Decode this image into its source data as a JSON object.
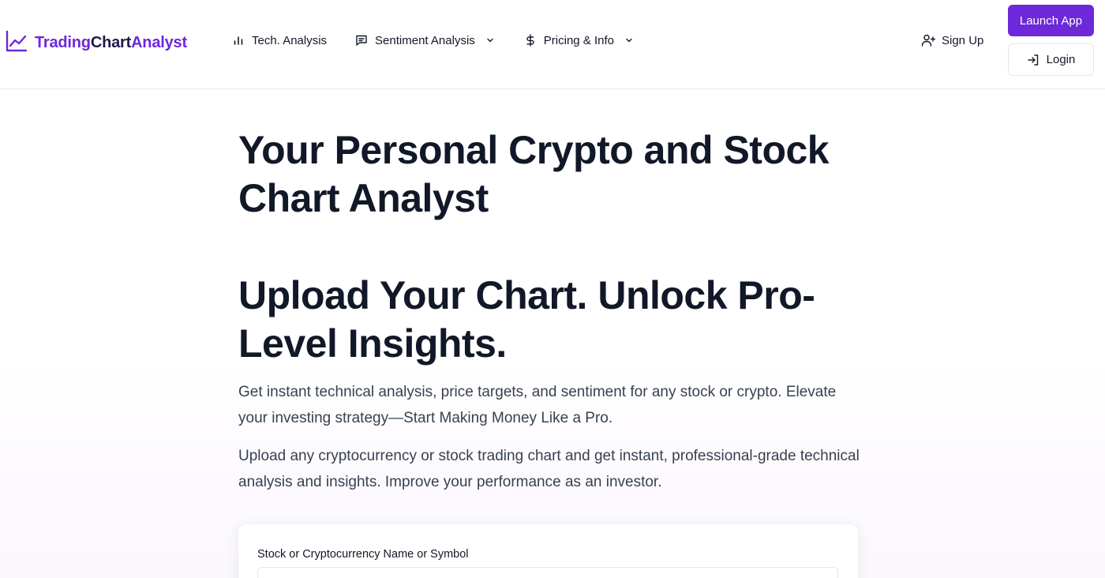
{
  "brand": {
    "part1": "Trading",
    "part2": "Chart",
    "part3": "Analyst",
    "accent_color": "#6d28d9",
    "icon": "chart-line-icon"
  },
  "nav": {
    "items": [
      {
        "label": "Tech. Analysis",
        "icon": "bar-chart-icon",
        "has_dropdown": false
      },
      {
        "label": "Sentiment Analysis",
        "icon": "message-square-icon",
        "has_dropdown": true
      },
      {
        "label": "Pricing & Info",
        "icon": "dollar-icon",
        "has_dropdown": true
      }
    ],
    "signup_label": "Sign Up",
    "launch_label": "Launch App",
    "login_label": "Login"
  },
  "hero": {
    "title": "Your Personal Crypto and Stock Chart Analyst",
    "subtitle": "Upload Your Chart. Unlock Pro-Level Insights.",
    "paragraph1": "Get instant technical analysis, price targets, and sentiment for any stock or crypto. Elevate your investing strategy—Start Making Money Like a Pro.",
    "paragraph2": "Upload any cryptocurrency or stock trading chart and get instant, professional-grade technical analysis and insights. Improve your performance as an investor."
  },
  "form": {
    "symbol_label": "Stock or Cryptocurrency Name or Symbol",
    "symbol_value": ""
  }
}
